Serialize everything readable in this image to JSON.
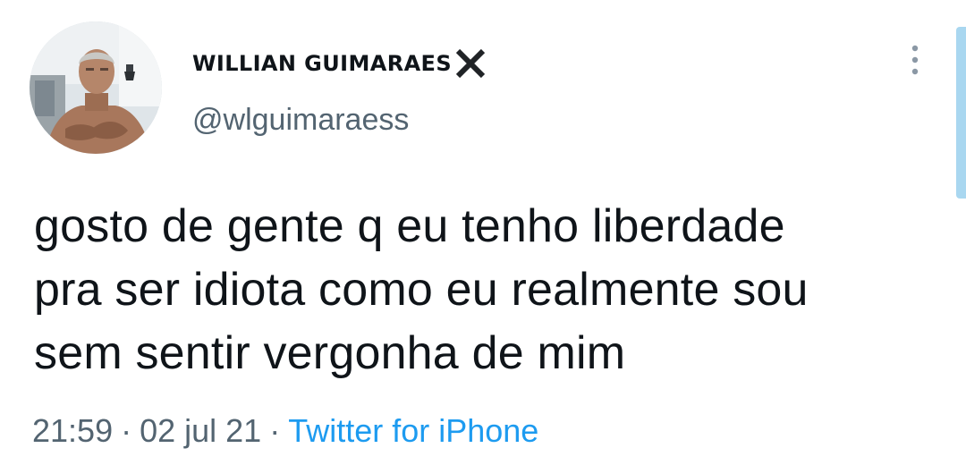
{
  "tweet": {
    "author": {
      "display_name": "WILLIAN GUIMARAES",
      "badge_icon": "x-mark-icon",
      "handle": "@wlguimaraess"
    },
    "text_lines": [
      "gosto de gente q eu tenho liberdade",
      "pra ser idiota como eu realmente sou",
      "sem sentir vergonha de mim"
    ],
    "time": "21:59",
    "date": "02 jul 21",
    "separator": "·",
    "source": "Twitter for iPhone",
    "more_icon": "vertical-dots-icon"
  },
  "colors": {
    "text_primary": "#0f1419",
    "text_secondary": "#536471",
    "link": "#1d9bf0",
    "scroll_indicator": "#a9d7f0"
  }
}
